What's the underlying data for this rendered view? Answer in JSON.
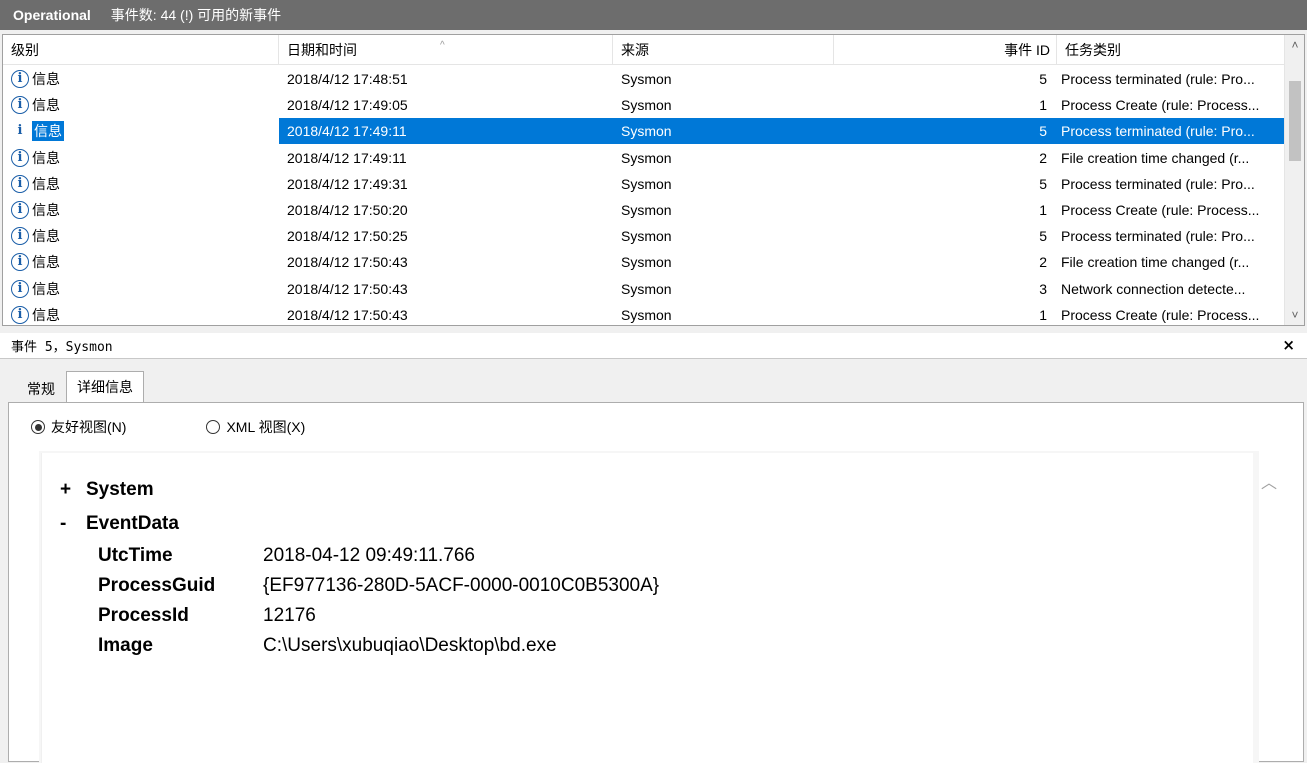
{
  "titlebar": {
    "name": "Operational",
    "summary": "事件数: 44 (!) 可用的新事件"
  },
  "list": {
    "columns": [
      "级别",
      "日期和时间",
      "来源",
      "事件 ID",
      "任务类别"
    ],
    "rows": [
      {
        "level": "信息",
        "datetime": "2018/4/12 17:48:51",
        "source": "Sysmon",
        "id": "5",
        "task": "Process terminated (rule: Pro...",
        "selected": false
      },
      {
        "level": "信息",
        "datetime": "2018/4/12 17:49:05",
        "source": "Sysmon",
        "id": "1",
        "task": "Process Create (rule: Process...",
        "selected": false
      },
      {
        "level": "信息",
        "datetime": "2018/4/12 17:49:11",
        "source": "Sysmon",
        "id": "5",
        "task": "Process terminated (rule: Pro...",
        "selected": true
      },
      {
        "level": "信息",
        "datetime": "2018/4/12 17:49:11",
        "source": "Sysmon",
        "id": "2",
        "task": "File creation time changed (r...",
        "selected": false
      },
      {
        "level": "信息",
        "datetime": "2018/4/12 17:49:31",
        "source": "Sysmon",
        "id": "5",
        "task": "Process terminated (rule: Pro...",
        "selected": false
      },
      {
        "level": "信息",
        "datetime": "2018/4/12 17:50:20",
        "source": "Sysmon",
        "id": "1",
        "task": "Process Create (rule: Process...",
        "selected": false
      },
      {
        "level": "信息",
        "datetime": "2018/4/12 17:50:25",
        "source": "Sysmon",
        "id": "5",
        "task": "Process terminated (rule: Pro...",
        "selected": false
      },
      {
        "level": "信息",
        "datetime": "2018/4/12 17:50:43",
        "source": "Sysmon",
        "id": "2",
        "task": "File creation time changed (r...",
        "selected": false
      },
      {
        "level": "信息",
        "datetime": "2018/4/12 17:50:43",
        "source": "Sysmon",
        "id": "3",
        "task": "Network connection detecte...",
        "selected": false
      },
      {
        "level": "信息",
        "datetime": "2018/4/12 17:50:43",
        "source": "Sysmon",
        "id": "1",
        "task": "Process Create (rule: Process...",
        "selected": false
      }
    ]
  },
  "detail": {
    "title": "事件 5，Sysmon",
    "close": "×",
    "tabs": [
      {
        "label": "常规",
        "active": false
      },
      {
        "label": "详细信息",
        "active": true
      }
    ],
    "views": {
      "friendly": "友好视图(N)",
      "xml": "XML 视图(X)",
      "selected": "friendly"
    },
    "system_toggle": "+",
    "system_label": "System",
    "eventdata_toggle": "-",
    "eventdata_label": "EventData",
    "fields": [
      {
        "key": "UtcTime",
        "value": "2018-04-12 09:49:11.766"
      },
      {
        "key": "ProcessGuid",
        "value": "{EF977136-280D-5ACF-0000-0010C0B5300A}"
      },
      {
        "key": "ProcessId",
        "value": "12176"
      },
      {
        "key": "Image",
        "value": "C:\\Users\\xubuqiao\\Desktop\\bd.exe"
      }
    ]
  },
  "colors": {
    "selection": "#0078d7",
    "titlebar": "#6d6d6d",
    "info_icon": "#1a5ea8"
  },
  "icons": {
    "level": "info-icon",
    "sort": "sort-caret-icon",
    "scroll_up": "chevron-up-icon",
    "scroll_down": "chevron-down-icon",
    "close": "close-icon"
  }
}
